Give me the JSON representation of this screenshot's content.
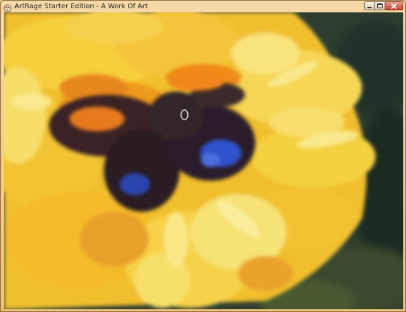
{
  "window": {
    "title": "ArtRage Starter Edition - A Work Of Art",
    "minimize_icon": "minimize-icon",
    "maximize_icon": "maximize-icon",
    "close_icon": "close-icon"
  },
  "canvas": {
    "subject": "",
    "brush_cursor_icon": "brush-cursor-icon"
  },
  "colors": {
    "titlebar": "#f3c77f",
    "petal_yellow": "#f3c32c",
    "petal_pale": "#f4e47a",
    "petal_orange": "#f09a1e",
    "dark_center": "#2b1e24",
    "blue_spot": "#2f4fc8",
    "background_dark": "#2c3a2c"
  }
}
